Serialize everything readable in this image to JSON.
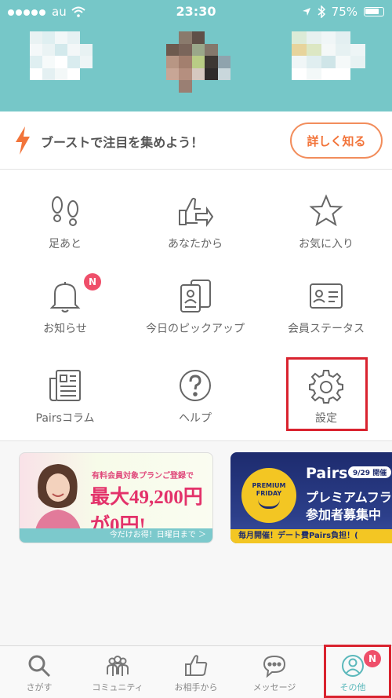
{
  "status_bar": {
    "carrier": "au",
    "time": "23:30",
    "battery": "75%"
  },
  "header": {
    "background": "#76c7c8"
  },
  "boost": {
    "text": "ブーストで注目を集めよう！",
    "button": "詳しく知る",
    "accent": "#f2743a"
  },
  "menu": {
    "items": [
      {
        "label": "足あと",
        "icon": "footprints-icon"
      },
      {
        "label": "あなたから",
        "icon": "thumbs-up-arrow-icon"
      },
      {
        "label": "お気に入り",
        "icon": "star-icon"
      },
      {
        "label": "お知らせ",
        "icon": "bell-icon",
        "badge": "N"
      },
      {
        "label": "今日のピックアップ",
        "icon": "cards-icon"
      },
      {
        "label": "会員ステータス",
        "icon": "id-card-icon"
      },
      {
        "label": "Pairsコラム",
        "icon": "newspaper-icon"
      },
      {
        "label": "ヘルプ",
        "icon": "help-icon"
      },
      {
        "label": "設定",
        "icon": "gear-icon"
      }
    ]
  },
  "banners": {
    "campaign": {
      "line1": "有料会員対象プランご登録で",
      "line2": "最大49,200円が0円!",
      "footer": "今だけお得！日曜日まで ＞"
    },
    "premium_friday": {
      "logo_top": "PREMIUM",
      "logo_bottom": "FRIDAY",
      "brand": "Pairs",
      "tag": "9/29 開催",
      "line1": "プレミアムフライ",
      "line2": "参加者募集中",
      "footer": "毎月開催！デート費Pairs負担！("
    }
  },
  "tabbar": {
    "items": [
      {
        "label": "さがす",
        "icon": "search-icon"
      },
      {
        "label": "コミュニティ",
        "icon": "community-icon"
      },
      {
        "label": "お相手から",
        "icon": "thumbs-up-icon"
      },
      {
        "label": "メッセージ",
        "icon": "message-icon"
      },
      {
        "label": "その他",
        "icon": "person-icon",
        "badge": "N",
        "active": true
      }
    ]
  }
}
